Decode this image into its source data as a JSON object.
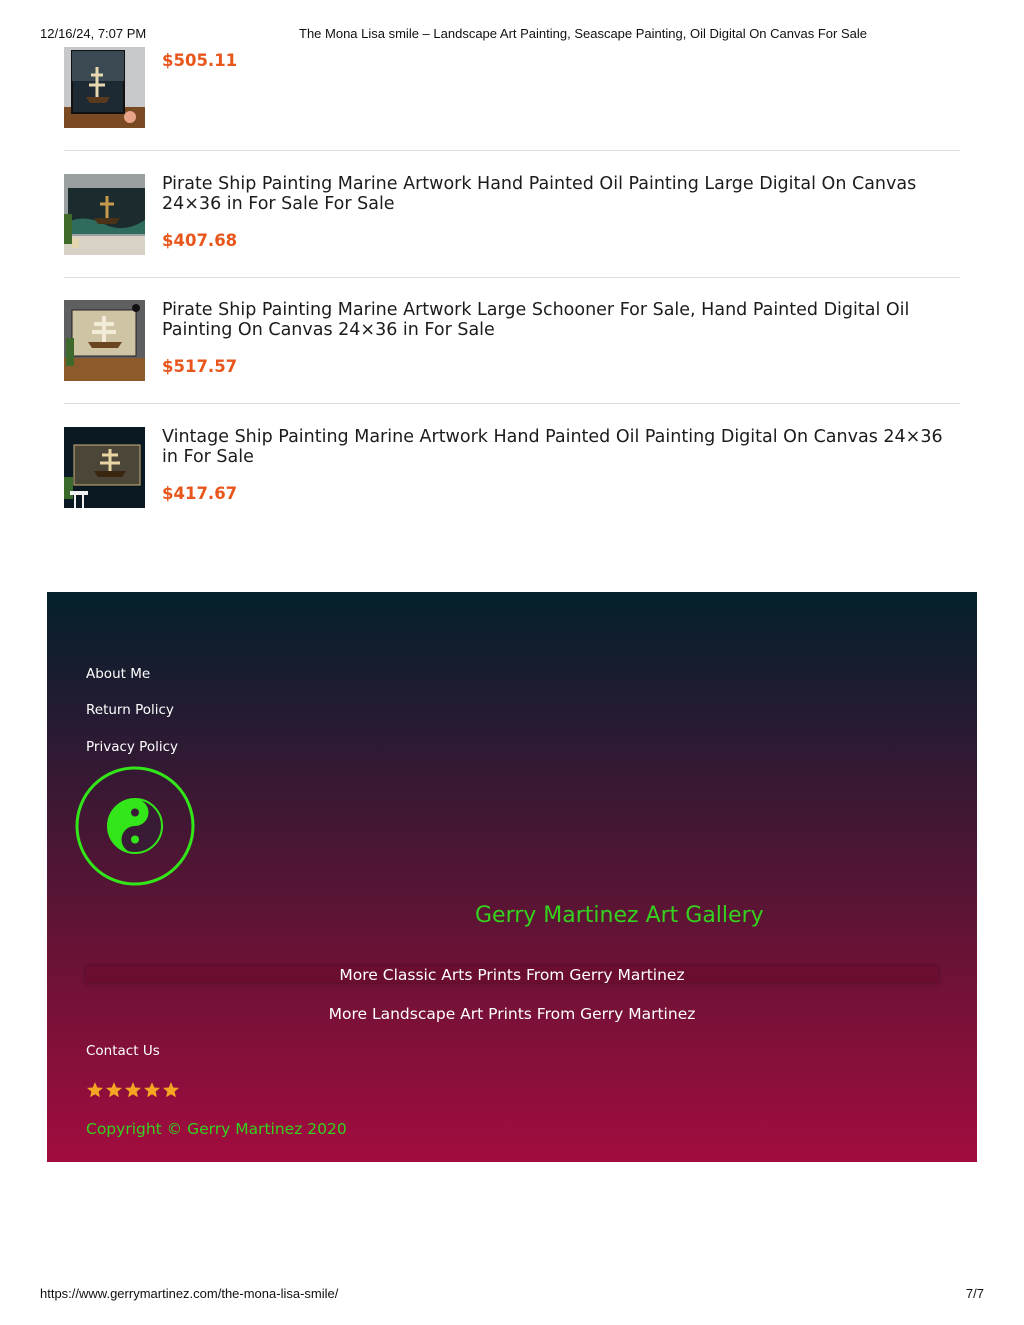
{
  "print": {
    "datetime": "12/16/24, 7:07 PM",
    "doc_title": "The Mona Lisa smile – Landscape Art Painting, Seascape Painting, Oil Digital On Canvas For Sale",
    "url": "https://www.gerrymartinez.com/the-mona-lisa-smile/",
    "page": "7/7"
  },
  "products": [
    {
      "name": "",
      "price": "$505.11"
    },
    {
      "name": "Pirate Ship Painting Marine Artwork Hand Painted Oil Painting Large Digital On Canvas 24×36 in For Sale For Sale",
      "price": "$407.68"
    },
    {
      "name": "Pirate Ship Painting Marine Artwork Large Schooner For Sale, Hand Painted Digital Oil Painting On Canvas 24×36 in For Sale",
      "price": "$517.57"
    },
    {
      "name": "Vintage Ship Painting Marine Artwork Hand Painted Oil Painting Digital On Canvas 24×36 in For Sale",
      "price": "$417.67"
    }
  ],
  "footer": {
    "links": [
      "About Me",
      "Return Policy",
      "Privacy Policy"
    ],
    "logo_icon": "yin-yang-icon",
    "brand": "Gerry Martinez Art Gallery",
    "more_classic": "More Classic Arts Prints From Gerry Martinez",
    "more_landscape": "More Landscape Art Prints From Gerry Martinez",
    "contact": "Contact Us",
    "rating_stars": 5,
    "copyright": "Copyright © Gerry Martinez 2020"
  },
  "colors": {
    "price": "#e8561c",
    "brand_green": "#34d11e",
    "star": "#f5a623"
  }
}
